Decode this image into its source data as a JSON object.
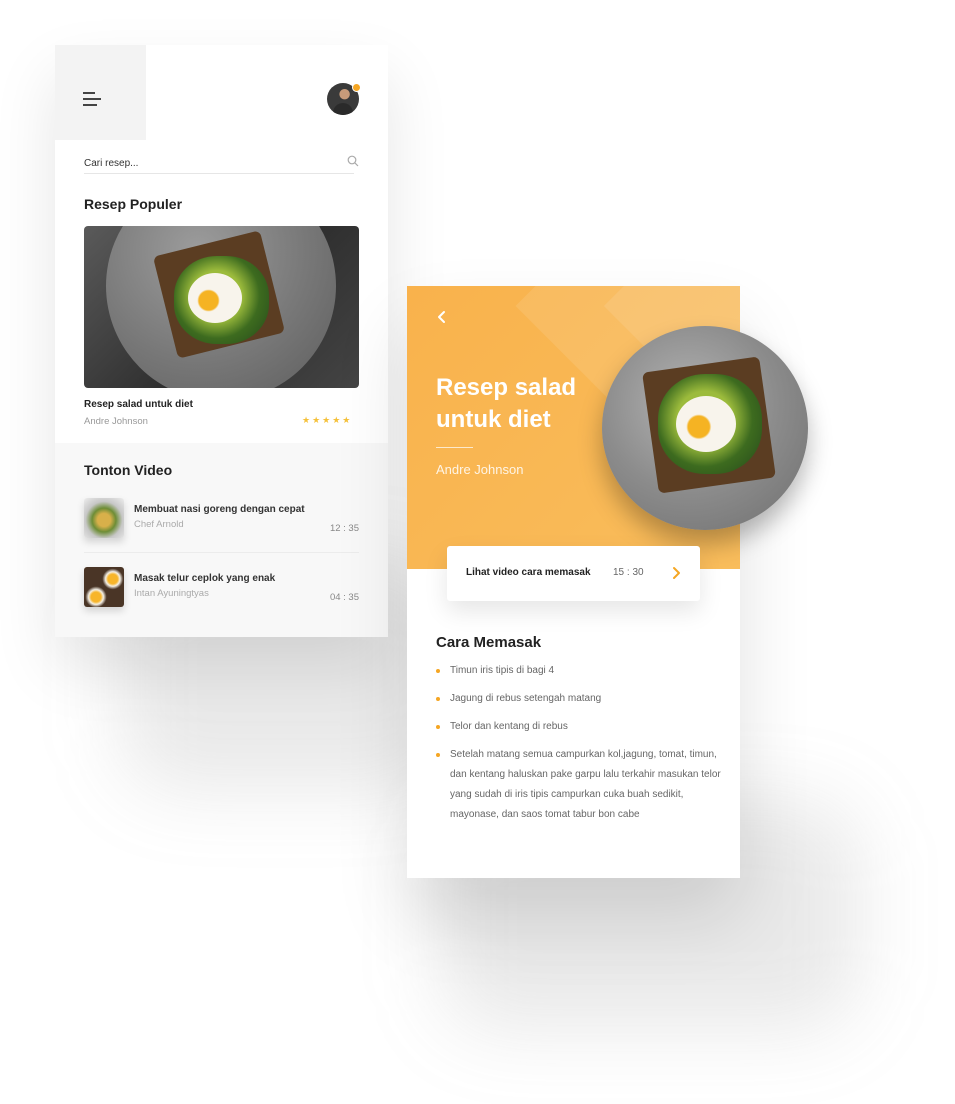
{
  "screen_list": {
    "search": {
      "placeholder": "Cari resep..."
    },
    "popular_title": "Resep Populer",
    "featured": {
      "title": "Resep salad untuk diet",
      "author": "Andre Johnson",
      "rating_stars": "★★★★★",
      "rating": 5
    },
    "video_section_title": "Tonton Video",
    "videos": [
      {
        "title": "Membuat nasi goreng dengan cepat",
        "author": "Chef Arnold",
        "duration": "12 : 35"
      },
      {
        "title": "Masak telur ceplok yang enak",
        "author": "Intan Ayuningtyas",
        "duration": "04 : 35"
      }
    ]
  },
  "screen_detail": {
    "title": "Resep salad untuk diet",
    "author": "Andre Johnson",
    "video_card": {
      "label": "Lihat video cara memasak",
      "duration": "15 : 30"
    },
    "cara_title": "Cara Memasak",
    "steps": [
      "Timun iris tipis di bagi 4",
      "Jagung di rebus setengah matang",
      "Telor dan kentang di rebus",
      "Setelah matang semua campurkan kol,jagung, tomat, timun, dan kentang haluskan pake garpu lalu terkahir masukan telor yang sudah di iris tipis campurkan cuka buah sedikit, mayonase, dan saos tomat tabur bon cabe"
    ]
  },
  "icons": {
    "menu": "hamburger-icon",
    "search": "search-icon",
    "back": "chevron-left-icon",
    "play": "chevron-right-icon",
    "bullet": "dot-icon"
  },
  "colors": {
    "accent": "#f5a623",
    "hero_bg": "#f9b24c",
    "stars": "#f5c13b",
    "text_dark": "#222222",
    "text_muted": "#999999"
  }
}
